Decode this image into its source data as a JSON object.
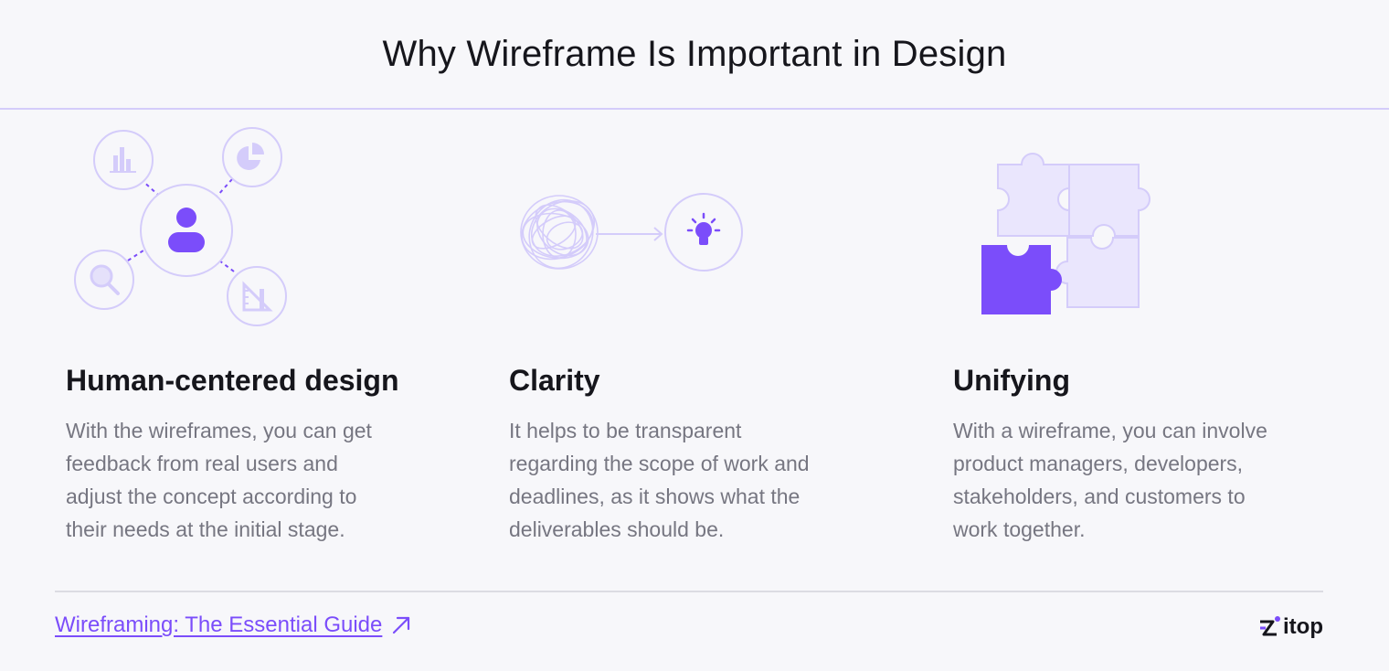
{
  "header": {
    "title": "Why Wireframe Is Important in Design"
  },
  "columns": [
    {
      "title": "Human-centered design",
      "lines": [
        "With the wireframes, you can get",
        "feedback from real users and",
        "adjust the concept according to",
        "their needs at the initial stage."
      ]
    },
    {
      "title": "Clarity",
      "lines": [
        "It helps to be transparent",
        "regarding the scope of work and",
        "deadlines, as it shows what the",
        "deliverables should be."
      ]
    },
    {
      "title": "Unifying",
      "lines": [
        "With a wireframe, you can involve",
        "product managers, developers,",
        "stakeholders, and customers to",
        "work together."
      ]
    }
  ],
  "footer": {
    "link_label": "Wireframing: The Essential Guide",
    "logo_text": "itop"
  },
  "colors": {
    "accent": "#7b4dfa",
    "accent_light": "#d4ccfa",
    "fill_light": "#eae6fd",
    "text_dark": "#16161c",
    "text_muted": "#767681"
  },
  "icons": [
    "user-icon",
    "bar-chart-icon",
    "pie-chart-icon",
    "magnifier-icon",
    "ruler-triangle-icon",
    "tangled-scribble-icon",
    "arrow-right-icon",
    "lightbulb-icon",
    "puzzle-icon",
    "external-link-arrow-icon",
    "logo-mark-icon"
  ]
}
